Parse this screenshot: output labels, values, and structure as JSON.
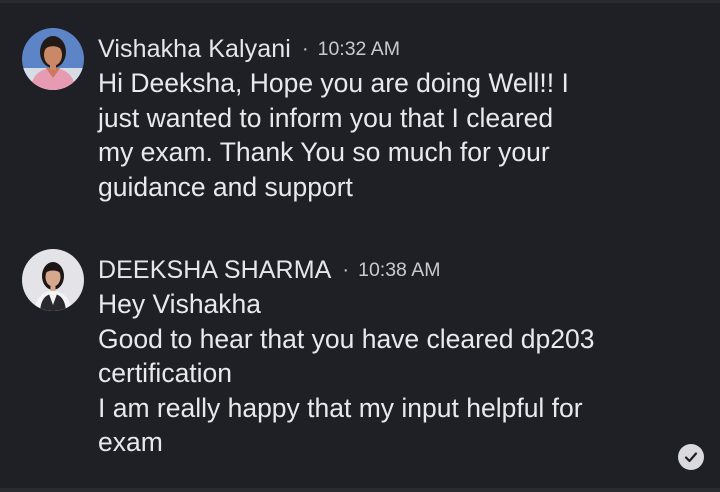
{
  "messages": [
    {
      "author": "Vishakha Kalyani",
      "separator": "·",
      "time": "10:32 AM",
      "lines": [
        "Hi Deeksha, Hope you are doing Well!! I",
        "just wanted to inform you that I cleared",
        "my exam. Thank You so much for your",
        "guidance and support"
      ]
    },
    {
      "author": "DEEKSHA SHARMA",
      "separator": "·",
      "time": "10:38 AM",
      "lines": [
        "Hey Vishakha",
        "Good to hear that you have cleared dp203",
        "certification",
        "I am really happy that my input helpful for",
        "exam"
      ]
    }
  ],
  "icons": {
    "read_status": "check-circle-icon"
  },
  "colors": {
    "background": "#1f1f26",
    "text": "#e9e9ed",
    "meta": "#c9c9cf"
  }
}
